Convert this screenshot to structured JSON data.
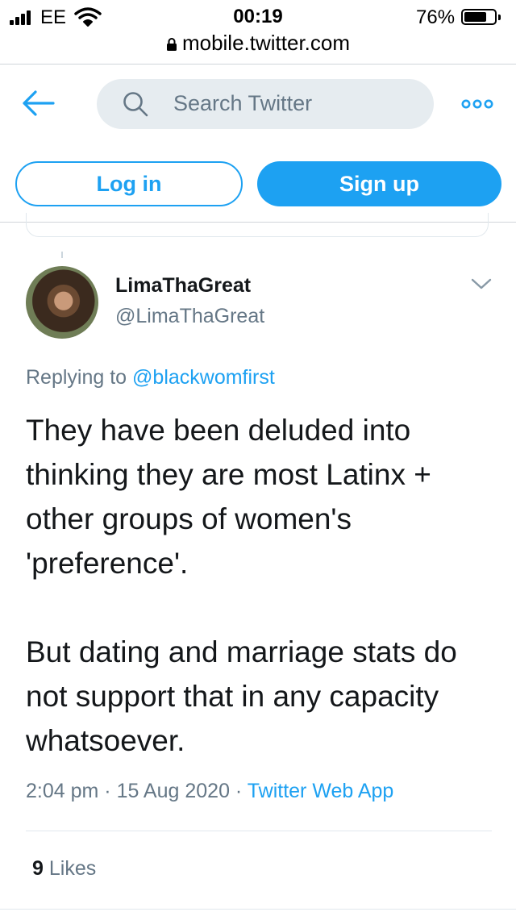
{
  "status_bar": {
    "carrier": "EE",
    "time": "00:19",
    "battery_percent": "76%",
    "battery_level": 0.76
  },
  "browser": {
    "url": "mobile.twitter.com"
  },
  "header": {
    "search_placeholder": "Search Twitter",
    "login_label": "Log in",
    "signup_label": "Sign up"
  },
  "tweet": {
    "display_name": "LimaThaGreat",
    "handle": "@LimaThaGreat",
    "replying_prefix": "Replying to",
    "replying_to": "@blackwomfirst",
    "text": "They have been deluded into thinking they are most Latinx + other groups of women's 'preference'.\n\nBut dating and marriage stats do not support that in any capacity whatsoever.",
    "time": "2:04 pm",
    "date": "15 Aug 2020",
    "source": "Twitter Web App",
    "likes_count": "9",
    "likes_label": "Likes"
  },
  "colors": {
    "accent": "#1da1f2",
    "text_primary": "#14171a",
    "text_secondary": "#657786",
    "search_bg": "#e6ecf0"
  },
  "icons": {
    "signal": "signal-bars-icon",
    "wifi": "wifi-icon",
    "battery": "battery-icon",
    "lock": "lock-icon",
    "back": "arrow-left-icon",
    "search": "search-icon",
    "more": "more-dots-icon",
    "caret": "chevron-down-icon"
  }
}
